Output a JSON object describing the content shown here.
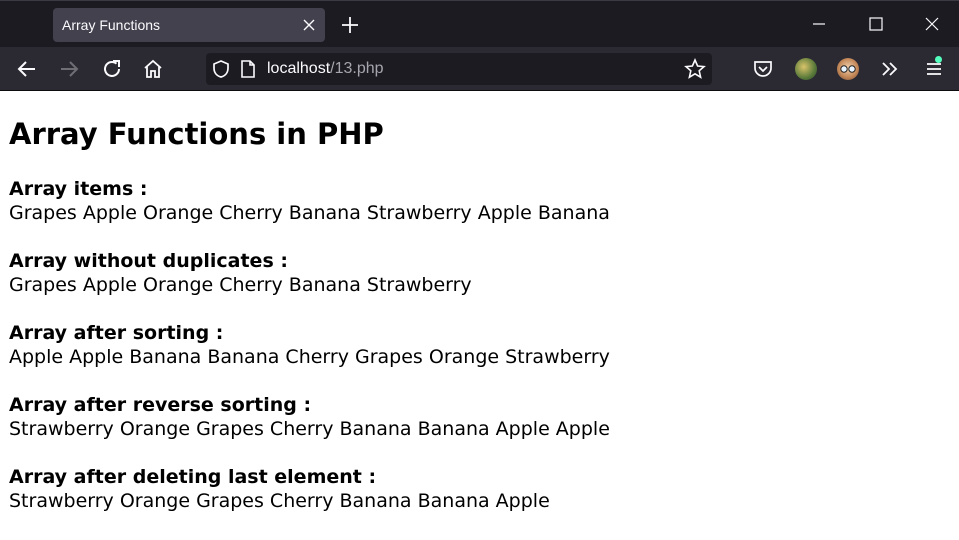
{
  "browser": {
    "tab_title": "Array Functions",
    "url_host": "localhost",
    "url_path": "/13.php"
  },
  "page": {
    "title": "Array Functions in PHP",
    "sections": [
      {
        "label": "Array items :",
        "value": "Grapes Apple Orange Cherry Banana Strawberry Apple Banana"
      },
      {
        "label": "Array without duplicates :",
        "value": "Grapes Apple Orange Cherry Banana Strawberry"
      },
      {
        "label": "Array after sorting :",
        "value": "Apple Apple Banana Banana Cherry Grapes Orange Strawberry"
      },
      {
        "label": "Array after reverse sorting :",
        "value": "Strawberry Orange Grapes Cherry Banana Banana Apple Apple"
      },
      {
        "label": "Array after deleting last element :",
        "value": "Strawberry Orange Grapes Cherry Banana Banana Apple"
      }
    ]
  },
  "colors": {
    "tabbar_bg": "#1c1b22",
    "navbar_bg": "#2b2a33",
    "urlbar_bg": "#1c1b22",
    "accent_dot": "#54ffbd"
  }
}
